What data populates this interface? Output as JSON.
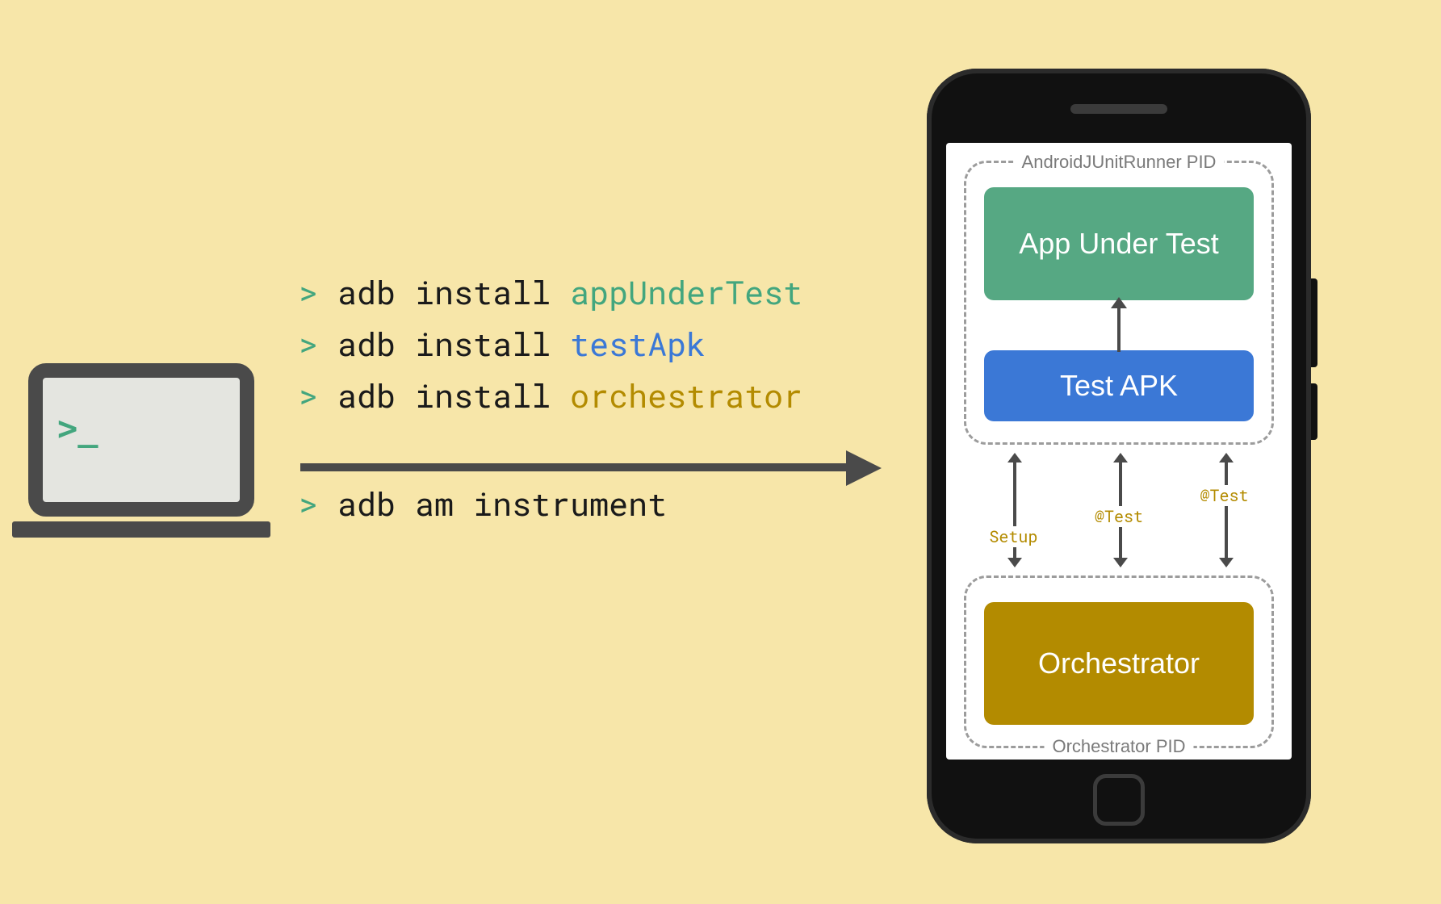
{
  "laptop": {
    "prompt": ">_"
  },
  "commands": {
    "prompt": ">",
    "line1_cmd": "adb install ",
    "line1_arg": "appUnderTest",
    "line2_cmd": "adb install ",
    "line2_arg": "testApk",
    "line3_cmd": "adb install ",
    "line3_arg": "orchestrator",
    "line4_cmd": "adb am instrument"
  },
  "phone": {
    "top_pid_label": "AndroidJUnitRunner PID",
    "bottom_pid_label": "Orchestrator PID",
    "block_app_under_test": "App Under Test",
    "block_test_apk": "Test APK",
    "block_orchestrator": "Orchestrator",
    "arrow_labels": {
      "setup": "Setup",
      "test1": "@Test",
      "test2": "@Test"
    }
  },
  "colors": {
    "background": "#f7e6a9",
    "green": "#56a883",
    "blue": "#3b78d6",
    "gold": "#b38b00",
    "dark": "#4a4a4a"
  }
}
